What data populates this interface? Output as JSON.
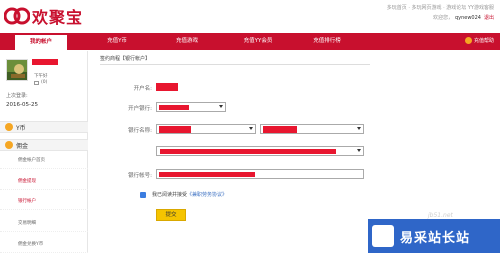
{
  "header": {
    "logo_text": "欢聚宝",
    "top_links": "多玩首页 · 多玩网页游戏 · 游戏论坛 YY游戏客服",
    "welcome": "欢迎您，",
    "username": "qynew024",
    "logout": "退出"
  },
  "nav": {
    "items": [
      {
        "label": "我的帐户",
        "active": true
      },
      {
        "label": "充值Y币",
        "active": false
      },
      {
        "label": "充值游戏",
        "active": false
      },
      {
        "label": "充值YY会员",
        "active": false
      },
      {
        "label": "充值排行榜",
        "active": false
      }
    ],
    "help": "充值帮助"
  },
  "sidebar": {
    "user_level": "下午好",
    "user_coin": "(0)",
    "last_login_label": "上次登录:",
    "last_login_date": "2016-05-25",
    "groups": [
      {
        "label": "Y币",
        "icon": "y-coin-icon"
      },
      {
        "label": "佣金",
        "icon": "commission-icon"
      }
    ],
    "items": [
      {
        "label": "佣金帐户首页",
        "highlight": false
      },
      {
        "label": "佣金提现",
        "highlight": true
      },
      {
        "label": "银行帐户",
        "highlight": true
      },
      {
        "label": "交易明细",
        "highlight": false
      },
      {
        "label": "佣金兑换Y币",
        "highlight": false
      }
    ]
  },
  "main": {
    "breadcrumb": "签约商程【银行帐户】",
    "labels": {
      "account_name": "开户名:",
      "bank": "开户银行:",
      "branch": "银行名称:",
      "account_number": "银行帐号:"
    },
    "agree_text": "我已阅读并接受",
    "agree_link": "《兼职劳务协议》",
    "submit": "提交"
  },
  "watermark": {
    "url": "jb51.net",
    "brand": "易采站长站"
  },
  "colors": {
    "brand": "#c8102e",
    "redaction": "#e8162f",
    "submit": "#f5c400",
    "accent_blue": "#3b7de0"
  }
}
